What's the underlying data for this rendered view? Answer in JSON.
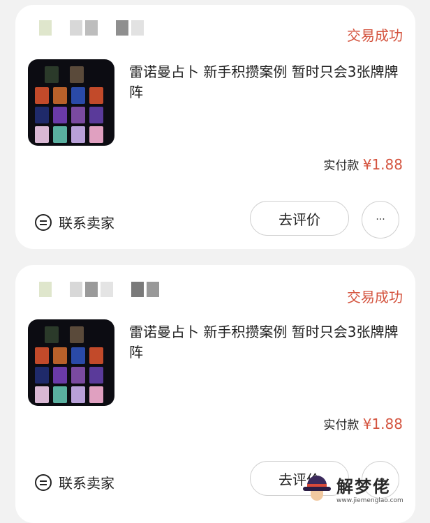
{
  "orders": [
    {
      "status": "交易成功",
      "title": "雷诺曼占卜 新手积攒案例 暂时只会3张牌牌阵",
      "paid_label": "实付款",
      "price": "¥1.88",
      "contact_label": "联系卖家",
      "review_label": "去评价",
      "more_label": "···"
    },
    {
      "status": "交易成功",
      "title": "雷诺曼占卜 新手积攒案例 暂时只会3张牌牌阵",
      "paid_label": "实付款",
      "price": "¥1.88",
      "contact_label": "联系卖家",
      "review_label": "去评价",
      "more_label": "···"
    }
  ],
  "watermark": {
    "title": "解梦佬",
    "url": "www.jiemenglao.com"
  },
  "colors": {
    "accent": "#d4533e",
    "background": "#f2f2f2",
    "card": "#ffffff"
  }
}
